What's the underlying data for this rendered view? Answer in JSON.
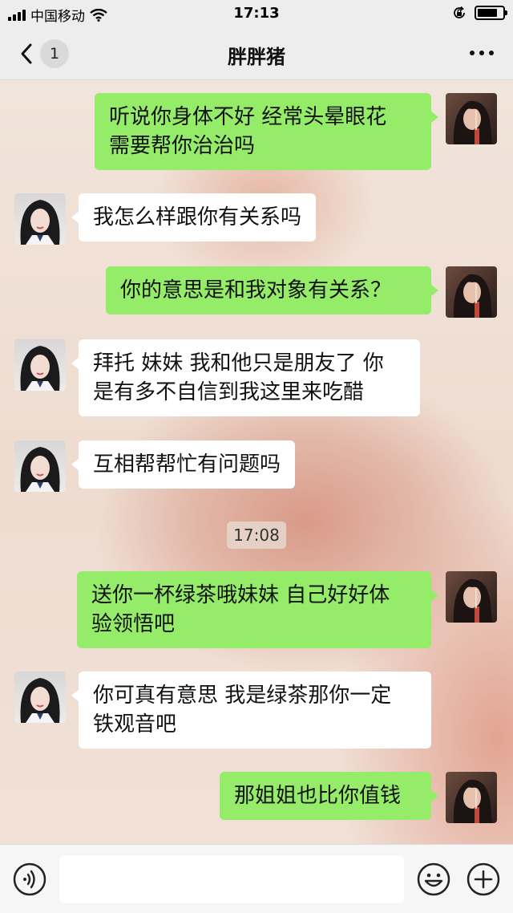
{
  "status_bar": {
    "carrier": "中国移动",
    "time": "17:13",
    "battery_level": 0.8
  },
  "nav": {
    "back_badge": "1",
    "title": "胖胖猪"
  },
  "messages": [
    {
      "side": "right",
      "text_lines": [
        "听说你身体不好 经常头晕眼花",
        "需要帮你治治吗"
      ]
    },
    {
      "side": "left",
      "text_lines": [
        "我怎么样跟你有关系吗"
      ]
    },
    {
      "side": "right",
      "text_lines": [
        "你的意思是和我对象有关系？"
      ]
    },
    {
      "side": "left",
      "text_lines": [
        "拜托 妹妹 我和他只是朋友了 你",
        "是有多不自信到我这里来吃醋"
      ]
    },
    {
      "side": "left",
      "text_lines": [
        "互相帮帮忙有问题吗"
      ]
    },
    {
      "side": "right",
      "text_lines": [
        "送你一杯绿茶哦妹妹 自己好好体",
        "验领悟吧"
      ]
    },
    {
      "side": "left",
      "text_lines": [
        "你可真有意思 我是绿茶那你一定",
        "铁观音吧"
      ]
    },
    {
      "side": "right",
      "text_lines": [
        "那姐姐也比你值钱"
      ]
    }
  ],
  "timestamp": "17:08",
  "colors": {
    "sent_bubble": "#95ec69",
    "received_bubble": "#ffffff",
    "bar_bg": "#ededed"
  },
  "icons": {
    "back": "chevron-left-icon",
    "more": "more-dots-icon",
    "voice": "voice-icon",
    "emoji": "emoji-icon",
    "plus": "plus-icon"
  }
}
